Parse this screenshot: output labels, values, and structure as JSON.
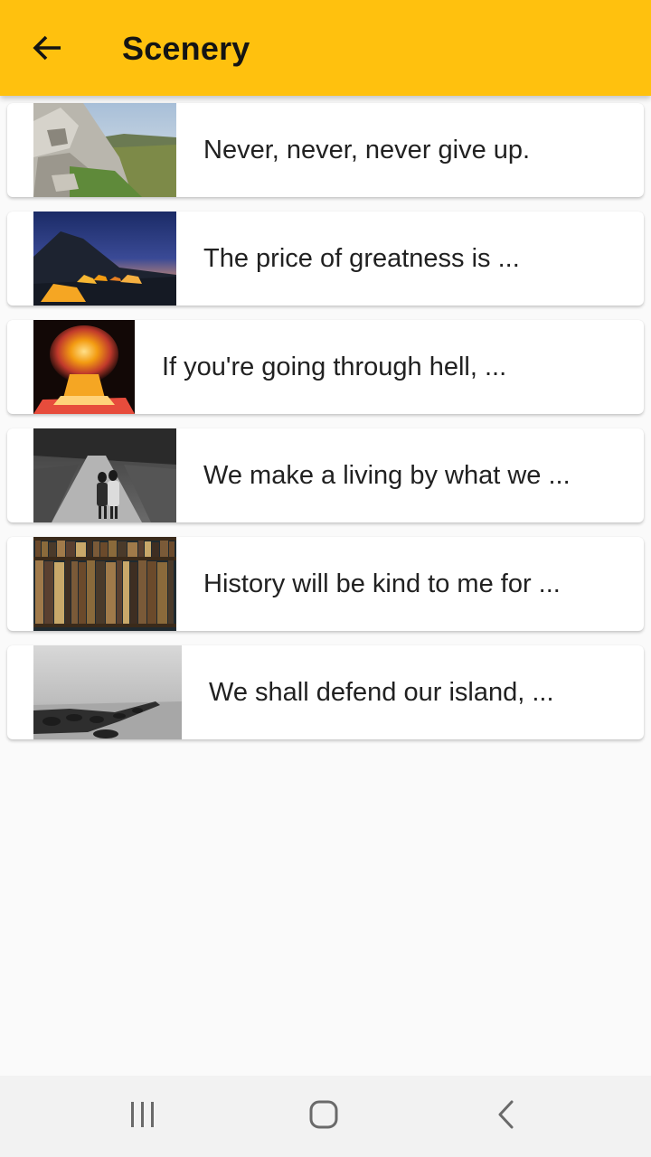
{
  "app_bar": {
    "title": "Scenery",
    "back_icon": "arrow-back-icon",
    "color": "#ffc10e"
  },
  "items": [
    {
      "text": "Never, never, never give up.",
      "image": "rocky-mountain-trail"
    },
    {
      "text": "The price of greatness is ...",
      "image": "tents-under-mountain-dusk"
    },
    {
      "text": "If you're going through hell, ...",
      "image": "fire-explosion"
    },
    {
      "text": "We make a living by what we ...",
      "image": "couple-walking-path"
    },
    {
      "text": "History will be kind to me for ...",
      "image": "bookshelf"
    },
    {
      "text": "We shall defend our island, ...",
      "image": "foggy-breakwater"
    }
  ],
  "system_nav": {
    "recents_icon": "recent-apps-icon",
    "home_icon": "home-icon",
    "back_icon": "system-back-icon"
  }
}
